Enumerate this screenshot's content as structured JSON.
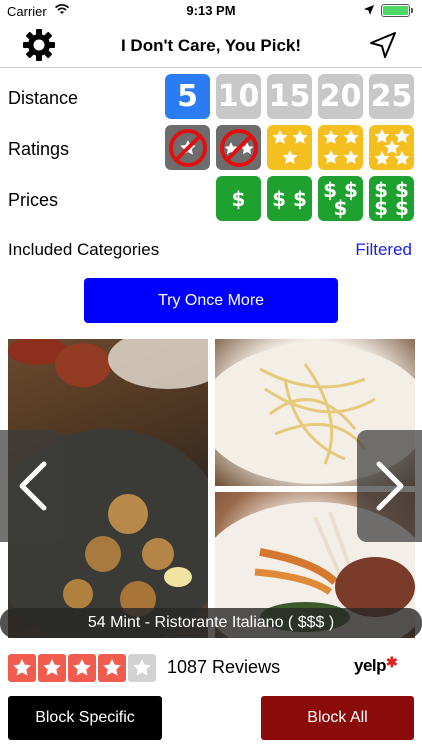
{
  "status_bar": {
    "carrier": "Carrier",
    "time": "9:13 PM",
    "wifi_icon": "wifi-icon",
    "location_icon": "location-arrow-icon",
    "battery_icon": "battery-icon"
  },
  "nav": {
    "title": "I Don't Care, You Pick!",
    "left_icon": "gear-icon",
    "right_icon": "navigation-arrow-icon"
  },
  "filters": {
    "distance": {
      "label": "Distance",
      "options": [
        {
          "label": "5",
          "selected": true
        },
        {
          "label": "10",
          "selected": false
        },
        {
          "label": "15",
          "selected": false
        },
        {
          "label": "20",
          "selected": false
        },
        {
          "label": "25",
          "selected": false
        }
      ]
    },
    "ratings": {
      "label": "Ratings",
      "options": [
        {
          "stars": 1,
          "selected": false
        },
        {
          "stars": 2,
          "selected": false
        },
        {
          "stars": 3,
          "selected": true
        },
        {
          "stars": 4,
          "selected": true
        },
        {
          "stars": 5,
          "selected": true
        }
      ]
    },
    "prices": {
      "label": "Prices",
      "options": [
        {
          "label": "$",
          "selected": true
        },
        {
          "label": "$$",
          "selected": true
        },
        {
          "label": "$$$",
          "selected": true
        },
        {
          "label": "$$$$",
          "selected": true
        }
      ]
    },
    "categories": {
      "label": "Included Categories",
      "link": "Filtered"
    }
  },
  "actions": {
    "try_again": "Try Once More",
    "block_specific": "Block Specific",
    "block_all": "Block All"
  },
  "result": {
    "caption": "54 Mint - Ristorante Italiano ( $$$ )",
    "rating_stars": 4,
    "max_stars": 5,
    "reviews": "1087 Reviews",
    "source": "yelp"
  },
  "colors": {
    "distance_selected": "#2b7cf2",
    "distance_unselected": "#c8c8c8",
    "rating_on": "#f5bf1f",
    "rating_off": "#6d6d6d",
    "price": "#1ea12e",
    "try_button": "#0000ff",
    "block_all": "#8b0a0a",
    "yelp_star": "#f15c4f",
    "link": "#2020d8"
  }
}
